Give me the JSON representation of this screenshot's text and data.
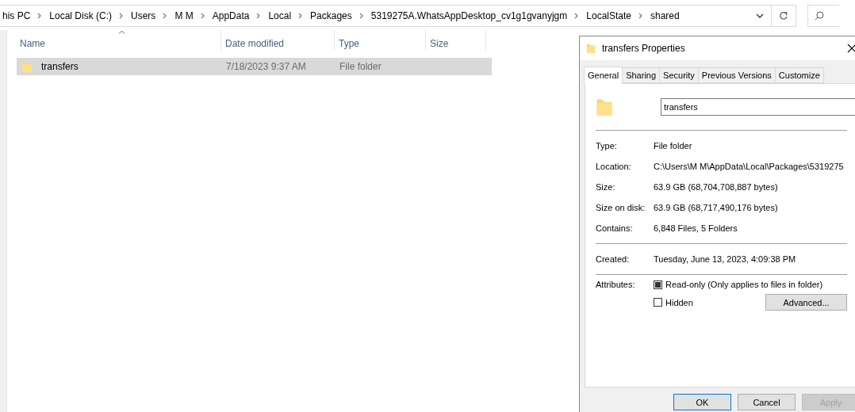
{
  "address_bar": {
    "crumbs": [
      "his PC",
      "Local Disk (C:)",
      "Users",
      "M M",
      "AppData",
      "Local",
      "Packages",
      "5319275A.WhatsAppDesktop_cv1g1gvanyjgm",
      "LocalState",
      "shared"
    ]
  },
  "file_list": {
    "columns": [
      {
        "label": "Name",
        "sorted": true
      },
      {
        "label": "Date modified",
        "sorted": false
      },
      {
        "label": "Type",
        "sorted": false
      },
      {
        "label": "Size",
        "sorted": false
      }
    ],
    "rows": [
      {
        "name": "transfers",
        "date": "7/18/2023 9:37 AM",
        "type": "File folder",
        "selected": true
      }
    ]
  },
  "dialog": {
    "title": "transfers Properties",
    "tabs": [
      {
        "label": "General",
        "selected": true
      },
      {
        "label": "Sharing",
        "selected": false
      },
      {
        "label": "Security",
        "selected": false
      },
      {
        "label": "Previous Versions",
        "selected": false
      },
      {
        "label": "Customize",
        "selected": false
      }
    ],
    "name_value": "transfers",
    "groups": [
      [
        {
          "label": "Type:",
          "value": "File folder"
        },
        {
          "label": "Location:",
          "value": "C:\\Users\\M M\\AppData\\Local\\Packages\\5319275"
        },
        {
          "label": "Size:",
          "value": "63.9 GB (68,704,708,887 bytes)"
        },
        {
          "label": "Size on disk:",
          "value": "63.9 GB (68,717,490,176 bytes)"
        },
        {
          "label": "Contains:",
          "value": "6,848 Files, 5 Folders"
        }
      ],
      [
        {
          "label": "Created:",
          "value": "Tuesday, June 13, 2023, 4:09:38 PM"
        }
      ]
    ],
    "attributes_label": "Attributes:",
    "attributes": [
      {
        "label": "Read-only (Only applies to files in folder)",
        "checked": false,
        "indeterminate": true
      },
      {
        "label": "Hidden",
        "checked": false,
        "indeterminate": false
      }
    ],
    "advanced_button": "Advanced...",
    "buttons": [
      {
        "label": "OK",
        "default": true,
        "disabled": false
      },
      {
        "label": "Cancel",
        "default": false,
        "disabled": false
      },
      {
        "label": "Apply",
        "default": false,
        "disabled": true
      }
    ]
  }
}
